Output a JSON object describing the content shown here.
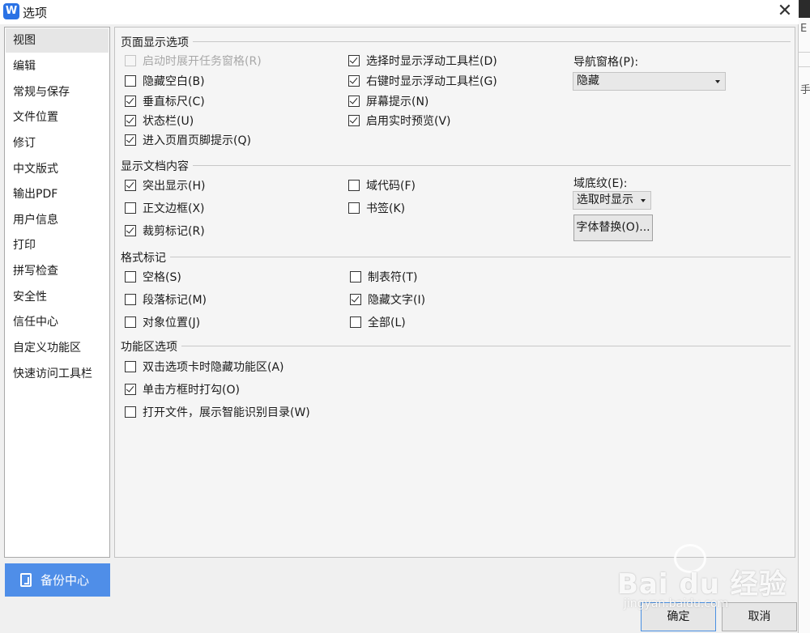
{
  "window": {
    "title": "选项",
    "app_icon_glyph": "W",
    "accent": "#2a72e5"
  },
  "sidebar": {
    "items": [
      {
        "label": "视图",
        "active": true
      },
      {
        "label": "编辑"
      },
      {
        "label": "常规与保存"
      },
      {
        "label": "文件位置"
      },
      {
        "label": "修订"
      },
      {
        "label": "中文版式"
      },
      {
        "label": "输出PDF"
      },
      {
        "label": "用户信息"
      },
      {
        "label": "打印"
      },
      {
        "label": "拼写检查"
      },
      {
        "label": "安全性"
      },
      {
        "label": "信任中心"
      },
      {
        "label": "自定义功能区"
      },
      {
        "label": "快速访问工具栏"
      }
    ],
    "backup_label": "备份中心",
    "backup_color": "#4f8ee8"
  },
  "sections": {
    "page_display": {
      "title": "页面显示选项",
      "options": [
        {
          "label": "启动时展开任务窗格(R)",
          "checked": false,
          "disabled": true
        },
        {
          "label": "隐藏空白(B)",
          "checked": false
        },
        {
          "label": "垂直标尺(C)",
          "checked": true
        },
        {
          "label": "状态栏(U)",
          "checked": true
        },
        {
          "label": "进入页眉页脚提示(Q)",
          "checked": true
        },
        {
          "label": "选择时显示浮动工具栏(D)",
          "checked": true
        },
        {
          "label": "右键时显示浮动工具栏(G)",
          "checked": true
        },
        {
          "label": "屏幕提示(N)",
          "checked": true
        },
        {
          "label": "启用实时预览(V)",
          "checked": true
        }
      ],
      "nav_pane_label": "导航窗格(P):",
      "nav_pane_value": "隐藏"
    },
    "doc_content": {
      "title": "显示文档内容",
      "options": [
        {
          "label": "突出显示(H)",
          "checked": true
        },
        {
          "label": "正文边框(X)",
          "checked": false
        },
        {
          "label": "裁剪标记(R)",
          "checked": true
        },
        {
          "label": "域代码(F)",
          "checked": false
        },
        {
          "label": "书签(K)",
          "checked": false
        }
      ],
      "field_shading_label": "域底纹(E):",
      "field_shading_value": "选取时显示",
      "font_substitution_button": "字体替换(O)..."
    },
    "format_marks": {
      "title": "格式标记",
      "options": [
        {
          "label": "空格(S)",
          "checked": false
        },
        {
          "label": "段落标记(M)",
          "checked": false
        },
        {
          "label": "对象位置(J)",
          "checked": false
        },
        {
          "label": "制表符(T)",
          "checked": false
        },
        {
          "label": "隐藏文字(I)",
          "checked": true
        },
        {
          "label": "全部(L)",
          "checked": false
        }
      ]
    },
    "ribbon": {
      "title": "功能区选项",
      "options": [
        {
          "label": "双击选项卡时隐藏功能区(A)",
          "checked": false
        },
        {
          "label": "单击方框时打勾(O)",
          "checked": true
        },
        {
          "label": "打开文件，展示智能识别目录(W)",
          "checked": false
        }
      ]
    }
  },
  "footer": {
    "ok_label": "确定",
    "cancel_label": "取消"
  },
  "watermark": {
    "brand": "Bai du 经验",
    "sub": "jingyan.baidu.com"
  },
  "background_app": {
    "chars": [
      "E",
      "手"
    ]
  }
}
